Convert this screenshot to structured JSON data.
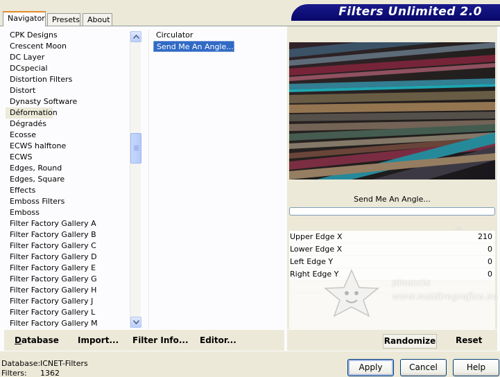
{
  "tabs": [
    "Navigator",
    "Presets",
    "About"
  ],
  "app_title": "Filters Unlimited 2.0",
  "filter_categories": [
    "CPK Designs",
    "Crescent Moon",
    "DC Layer",
    "DCspecial",
    "Distortion Filters",
    "Distort",
    "Dynasty Software",
    "Déformation",
    "Dégradés",
    "Ecosse",
    "ECWS halftone",
    "ECWS",
    "Edges, Round",
    "Edges, Square",
    "Effects",
    "Emboss Filters",
    "Emboss",
    "Filter Factory Gallery A",
    "Filter Factory Gallery B",
    "Filter Factory Gallery C",
    "Filter Factory Gallery D",
    "Filter Factory Gallery E",
    "Filter Factory Gallery G",
    "Filter Factory Gallery H",
    "Filter Factory Gallery J",
    "Filter Factory Gallery L",
    "Filter Factory Gallery M"
  ],
  "selected_category": "Déformation",
  "effects": [
    "Circulator",
    "Send Me An Angle..."
  ],
  "selected_effect": "Send Me An Angle...",
  "preview_effect_name": "Send Me An Angle...",
  "parameters": [
    {
      "label": "Upper Edge X",
      "value": "210"
    },
    {
      "label": "Lower Edge X",
      "value": "0"
    },
    {
      "label": "Left Edge Y",
      "value": "0"
    },
    {
      "label": "Right Edge Y",
      "value": "0"
    }
  ],
  "watermark": {
    "line1": "pinuccia",
    "line2": "www.maidiregrafica.eu"
  },
  "toolbar_left": {
    "database": "Database",
    "import": "Import...",
    "filter_info": "Filter Info...",
    "editor": "Editor..."
  },
  "toolbar_right": {
    "randomize": "Randomize",
    "reset": "Reset"
  },
  "status": {
    "database_label": "Database:",
    "database_value": "ICNET-Filters",
    "filters_label": "Filters:",
    "filters_value": "1362"
  },
  "buttons": {
    "apply": "Apply",
    "cancel": "Cancel",
    "help": "Help"
  },
  "colors": {
    "title_banner": "#07076a",
    "selection": "#316ac5",
    "tab_highlight": "#e68b2c"
  },
  "icons": [
    "scroll-up-arrow-icon",
    "scroll-down-arrow-icon",
    "scroll-thumb-grip-icon",
    "star-mascot-icon"
  ]
}
